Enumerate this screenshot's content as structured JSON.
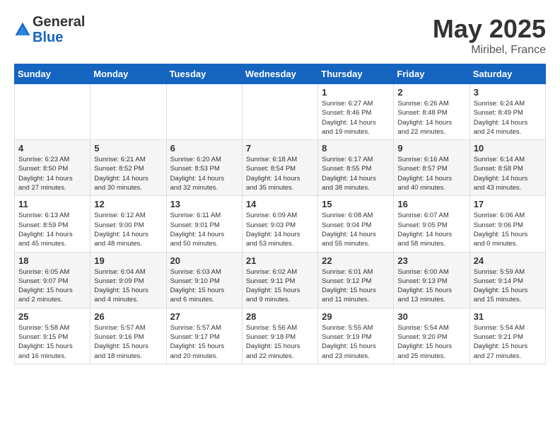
{
  "logo": {
    "general": "General",
    "blue": "Blue"
  },
  "title": "May 2025",
  "location": "Miribel, France",
  "days_of_week": [
    "Sunday",
    "Monday",
    "Tuesday",
    "Wednesday",
    "Thursday",
    "Friday",
    "Saturday"
  ],
  "weeks": [
    [
      {
        "day": "",
        "info": ""
      },
      {
        "day": "",
        "info": ""
      },
      {
        "day": "",
        "info": ""
      },
      {
        "day": "",
        "info": ""
      },
      {
        "day": "1",
        "info": "Sunrise: 6:27 AM\nSunset: 8:46 PM\nDaylight: 14 hours\nand 19 minutes."
      },
      {
        "day": "2",
        "info": "Sunrise: 6:26 AM\nSunset: 8:48 PM\nDaylight: 14 hours\nand 22 minutes."
      },
      {
        "day": "3",
        "info": "Sunrise: 6:24 AM\nSunset: 8:49 PM\nDaylight: 14 hours\nand 24 minutes."
      }
    ],
    [
      {
        "day": "4",
        "info": "Sunrise: 6:23 AM\nSunset: 8:50 PM\nDaylight: 14 hours\nand 27 minutes."
      },
      {
        "day": "5",
        "info": "Sunrise: 6:21 AM\nSunset: 8:52 PM\nDaylight: 14 hours\nand 30 minutes."
      },
      {
        "day": "6",
        "info": "Sunrise: 6:20 AM\nSunset: 8:53 PM\nDaylight: 14 hours\nand 32 minutes."
      },
      {
        "day": "7",
        "info": "Sunrise: 6:18 AM\nSunset: 8:54 PM\nDaylight: 14 hours\nand 35 minutes."
      },
      {
        "day": "8",
        "info": "Sunrise: 6:17 AM\nSunset: 8:55 PM\nDaylight: 14 hours\nand 38 minutes."
      },
      {
        "day": "9",
        "info": "Sunrise: 6:16 AM\nSunset: 8:57 PM\nDaylight: 14 hours\nand 40 minutes."
      },
      {
        "day": "10",
        "info": "Sunrise: 6:14 AM\nSunset: 8:58 PM\nDaylight: 14 hours\nand 43 minutes."
      }
    ],
    [
      {
        "day": "11",
        "info": "Sunrise: 6:13 AM\nSunset: 8:59 PM\nDaylight: 14 hours\nand 45 minutes."
      },
      {
        "day": "12",
        "info": "Sunrise: 6:12 AM\nSunset: 9:00 PM\nDaylight: 14 hours\nand 48 minutes."
      },
      {
        "day": "13",
        "info": "Sunrise: 6:11 AM\nSunset: 9:01 PM\nDaylight: 14 hours\nand 50 minutes."
      },
      {
        "day": "14",
        "info": "Sunrise: 6:09 AM\nSunset: 9:03 PM\nDaylight: 14 hours\nand 53 minutes."
      },
      {
        "day": "15",
        "info": "Sunrise: 6:08 AM\nSunset: 9:04 PM\nDaylight: 14 hours\nand 55 minutes."
      },
      {
        "day": "16",
        "info": "Sunrise: 6:07 AM\nSunset: 9:05 PM\nDaylight: 14 hours\nand 58 minutes."
      },
      {
        "day": "17",
        "info": "Sunrise: 6:06 AM\nSunset: 9:06 PM\nDaylight: 15 hours\nand 0 minutes."
      }
    ],
    [
      {
        "day": "18",
        "info": "Sunrise: 6:05 AM\nSunset: 9:07 PM\nDaylight: 15 hours\nand 2 minutes."
      },
      {
        "day": "19",
        "info": "Sunrise: 6:04 AM\nSunset: 9:09 PM\nDaylight: 15 hours\nand 4 minutes."
      },
      {
        "day": "20",
        "info": "Sunrise: 6:03 AM\nSunset: 9:10 PM\nDaylight: 15 hours\nand 6 minutes."
      },
      {
        "day": "21",
        "info": "Sunrise: 6:02 AM\nSunset: 9:11 PM\nDaylight: 15 hours\nand 9 minutes."
      },
      {
        "day": "22",
        "info": "Sunrise: 6:01 AM\nSunset: 9:12 PM\nDaylight: 15 hours\nand 11 minutes."
      },
      {
        "day": "23",
        "info": "Sunrise: 6:00 AM\nSunset: 9:13 PM\nDaylight: 15 hours\nand 13 minutes."
      },
      {
        "day": "24",
        "info": "Sunrise: 5:59 AM\nSunset: 9:14 PM\nDaylight: 15 hours\nand 15 minutes."
      }
    ],
    [
      {
        "day": "25",
        "info": "Sunrise: 5:58 AM\nSunset: 9:15 PM\nDaylight: 15 hours\nand 16 minutes."
      },
      {
        "day": "26",
        "info": "Sunrise: 5:57 AM\nSunset: 9:16 PM\nDaylight: 15 hours\nand 18 minutes."
      },
      {
        "day": "27",
        "info": "Sunrise: 5:57 AM\nSunset: 9:17 PM\nDaylight: 15 hours\nand 20 minutes."
      },
      {
        "day": "28",
        "info": "Sunrise: 5:56 AM\nSunset: 9:18 PM\nDaylight: 15 hours\nand 22 minutes."
      },
      {
        "day": "29",
        "info": "Sunrise: 5:55 AM\nSunset: 9:19 PM\nDaylight: 15 hours\nand 23 minutes."
      },
      {
        "day": "30",
        "info": "Sunrise: 5:54 AM\nSunset: 9:20 PM\nDaylight: 15 hours\nand 25 minutes."
      },
      {
        "day": "31",
        "info": "Sunrise: 5:54 AM\nSunset: 9:21 PM\nDaylight: 15 hours\nand 27 minutes."
      }
    ]
  ]
}
